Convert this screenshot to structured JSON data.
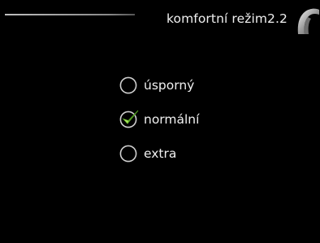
{
  "header": {
    "title": "komfortní režim2.2",
    "icon": "tap-faucet-icon"
  },
  "options": [
    {
      "label": "úsporný",
      "selected": false
    },
    {
      "label": "normální",
      "selected": true
    },
    {
      "label": "extra",
      "selected": false
    }
  ],
  "colors": {
    "background": "#000000",
    "text": "#f0f0f0",
    "check": "#7fcf3a"
  }
}
